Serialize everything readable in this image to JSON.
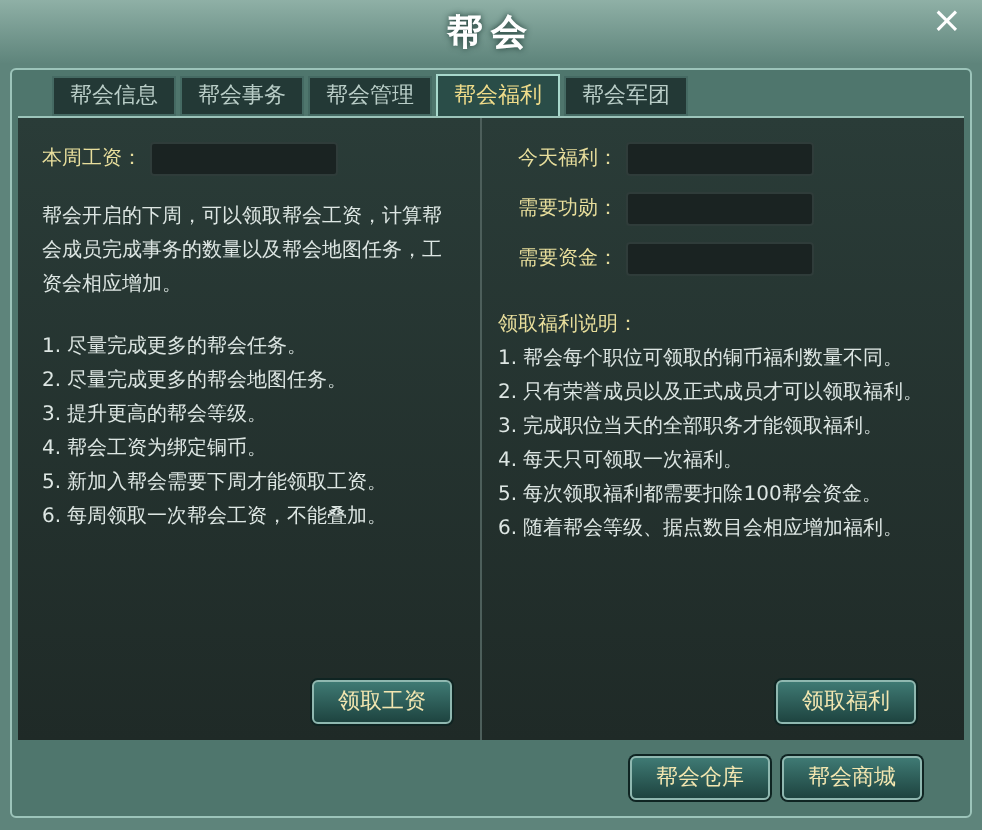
{
  "window": {
    "title": "帮会",
    "close": "×"
  },
  "tabs": [
    {
      "label": "帮会信息",
      "selected": false
    },
    {
      "label": "帮会事务",
      "selected": false
    },
    {
      "label": "帮会管理",
      "selected": false
    },
    {
      "label": "帮会福利",
      "selected": true
    },
    {
      "label": "帮会军团",
      "selected": false
    }
  ],
  "salary": {
    "label": "本周工资：",
    "intro": "帮会开启的下周，可以领取帮会工资，计算帮会成员完成事务的数量以及帮会地图任务，工资会相应增加。",
    "rules": [
      "1. 尽量完成更多的帮会任务。",
      "2. 尽量完成更多的帮会地图任务。",
      "3. 提升更高的帮会等级。",
      "4. 帮会工资为绑定铜币。",
      "5. 新加入帮会需要下周才能领取工资。",
      "6. 每周领取一次帮会工资，不能叠加。"
    ],
    "button": "领取工资"
  },
  "welfare": {
    "fields": [
      {
        "label": "今天福利："
      },
      {
        "label": "需要功勋："
      },
      {
        "label": "需要资金："
      }
    ],
    "heading": "领取福利说明：",
    "rules": [
      "1. 帮会每个职位可领取的铜币福利数量不同。",
      "2. 只有荣誉成员以及正式成员才可以领取福利。",
      "3. 完成职位当天的全部职务才能领取福利。",
      "4. 每天只可领取一次福利。",
      "5. 每次领取福利都需要扣除100帮会资金。",
      "6. 随着帮会等级、据点数目会相应增加福利。"
    ],
    "button": "领取福利"
  },
  "footer_buttons": [
    "帮会仓库",
    "帮会商城"
  ]
}
